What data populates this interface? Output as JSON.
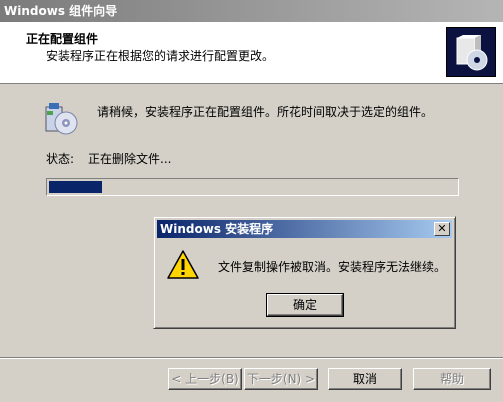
{
  "window": {
    "title": "Windows 组件向导",
    "header_title": "正在配置组件",
    "header_subtitle": "安装程序正在根据您的请求进行配置更改。",
    "info_text": "请稍候，安装程序正在配置组件。所花时间取决于选定的组件。",
    "status_label": "状态:",
    "status_value": "正在删除文件...",
    "progress_fraction": 0.13,
    "buttons": {
      "back": "< 上一步(B)",
      "next": "下一步(N) >",
      "cancel": "取消",
      "help": "帮助"
    }
  },
  "dialog": {
    "title": "Windows 安装程序",
    "message": "文件复制操作被取消。安装程序无法继续。",
    "ok_label": "确定",
    "close_label": "✕"
  },
  "colors": {
    "progress": "#0a246a",
    "dialog_title_start": "#0a246a",
    "window_title_start": "#7b7b7b"
  },
  "icons": {
    "header_logo": "software-box-icon",
    "main": "computer-cd-icon",
    "warning": "warning-icon"
  }
}
